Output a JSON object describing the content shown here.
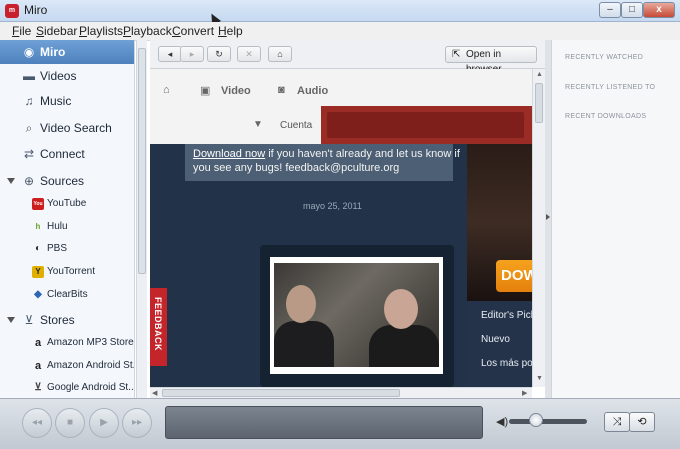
{
  "window": {
    "title": "Miro",
    "app_icon_text": "m",
    "minimize": "–",
    "maximize": "□",
    "close": "x"
  },
  "menu": [
    "File",
    "Sidebar",
    "Playlists",
    "Playback",
    "Convert",
    "Help"
  ],
  "sidebar": {
    "items": [
      {
        "label": "Miro",
        "icon": "miro-icon",
        "glyph": "◉",
        "active": true
      },
      {
        "label": "Videos",
        "icon": "videos-icon",
        "glyph": "▬"
      },
      {
        "label": "Music",
        "icon": "music-icon",
        "glyph": "♫"
      },
      {
        "label": "Video Search",
        "icon": "search-icon",
        "glyph": "⌕"
      },
      {
        "label": "Connect",
        "icon": "connect-icon",
        "glyph": "⇄"
      }
    ],
    "sources_label": "Sources",
    "sources": [
      {
        "label": "YouTube",
        "icon": "youtube-icon",
        "glyph": "You",
        "color": "#cc2020"
      },
      {
        "label": "Hulu",
        "icon": "hulu-icon",
        "glyph": "h",
        "color": "#6aa531"
      },
      {
        "label": "PBS",
        "icon": "pbs-icon",
        "glyph": "◐",
        "color": "#333333"
      },
      {
        "label": "YouTorrent",
        "icon": "youtorrent-icon",
        "glyph": "Y",
        "color": "#e0b000"
      },
      {
        "label": "ClearBits",
        "icon": "clearbits-icon",
        "glyph": "◆",
        "color": "#2c66b5"
      }
    ],
    "stores_label": "Stores",
    "stores": [
      {
        "label": "Amazon MP3 Store",
        "icon": "amazon-icon",
        "glyph": "a"
      },
      {
        "label": "Amazon Android St...",
        "icon": "amazon-icon",
        "glyph": "a"
      },
      {
        "label": "Google Android St...",
        "icon": "cart-icon",
        "glyph": "⊻"
      }
    ]
  },
  "browser": {
    "back": "◂",
    "forward": "▸",
    "reload": "↻",
    "stop": "✕",
    "home": "⌂",
    "open_in_browser": "Open in browser",
    "page": {
      "nav_video": "Video",
      "nav_audio": "Audio",
      "account": "Cuenta",
      "notice_link": "Download now",
      "notice_line1_rest": " if you haven't already and let us know if",
      "notice_line2": "you see any bugs! feedback@pculture.org",
      "date": "mayo 25, 2011",
      "feedback": "FEEDBACK",
      "download_partial": "DOW",
      "right_links": [
        "Editor's Pick",
        "Nuevo",
        "Los más pop"
      ]
    }
  },
  "right_panel": {
    "recently_watched": "RECENTLY WATCHED",
    "recently_listened": "RECENTLY LISTENED TO",
    "recent_downloads": "RECENT DOWNLOADS"
  },
  "player": {
    "prev": "◂◂",
    "stop": "■",
    "play": "▶",
    "next": "▸▸",
    "volume_icon": "◀)",
    "volume_level": 0.35,
    "shuffle": "⤨",
    "repeat": "⟲"
  },
  "colors": {
    "accent": "#4e81bd",
    "feedback": "#c3252b",
    "red_bar": "#9a2b25",
    "download": "#f6a21e"
  }
}
